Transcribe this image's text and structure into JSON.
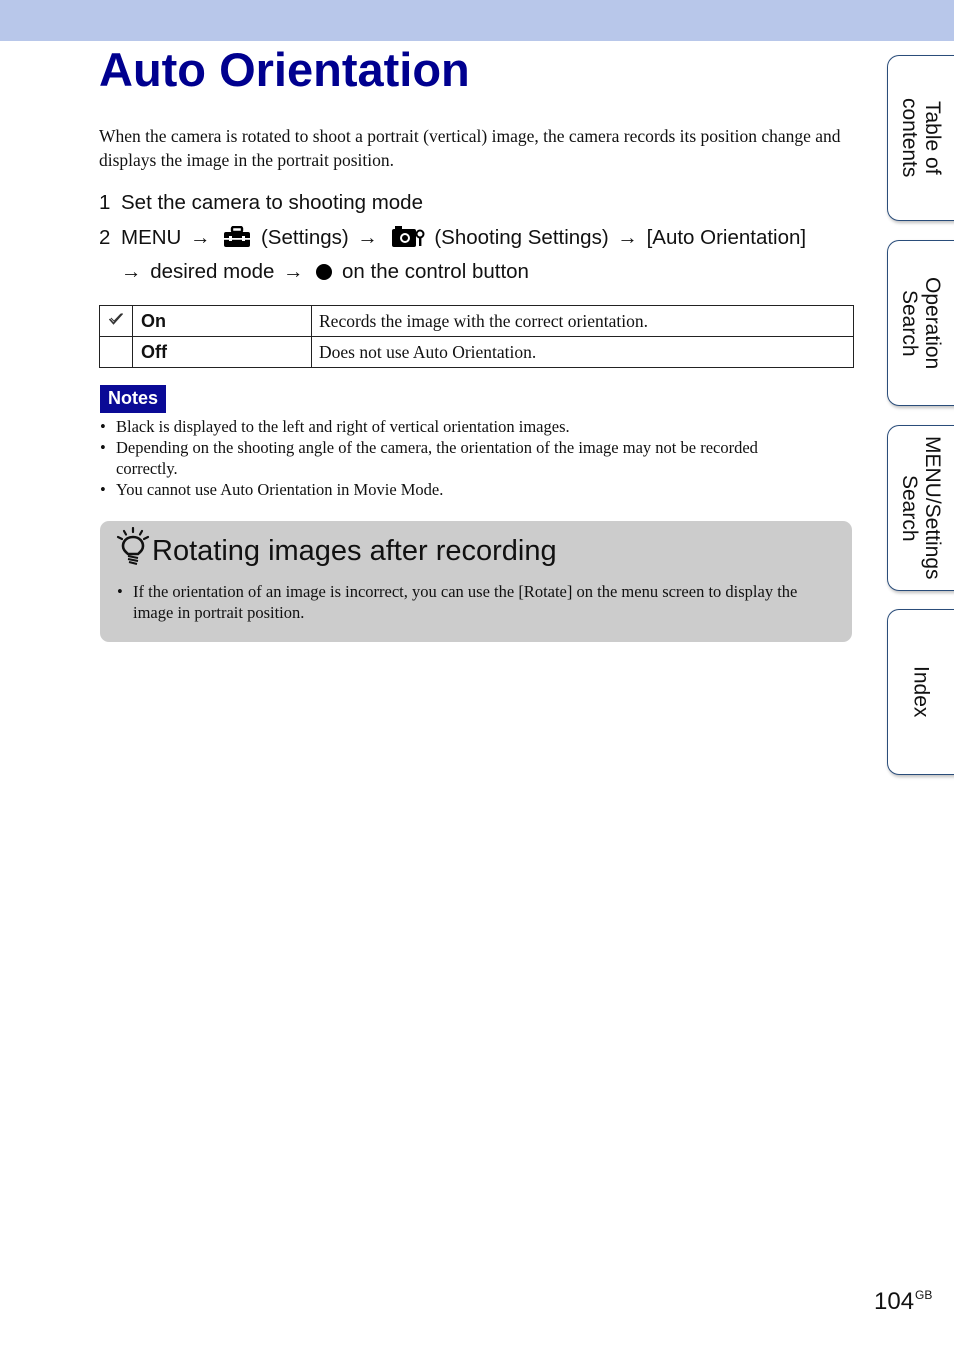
{
  "header": {
    "title": "Auto Orientation",
    "band_color": "#b8c7ea",
    "title_color": "#00008f"
  },
  "intro": "When the camera is rotated to shoot a portrait (vertical) image, the camera records its position change and displays the image in the portrait position.",
  "steps": [
    {
      "number": "1",
      "text": "Set the camera to shooting mode"
    },
    {
      "number": "2",
      "parts": {
        "menu": "MENU",
        "settings_icon": "toolbox-icon",
        "settings": "(Settings)",
        "shooting_icon": "camera-wrench-icon",
        "shooting": "(Shooting Settings)",
        "item": "[Auto Orientation]",
        "desired": "desired mode",
        "button_icon": "filled-circle-icon",
        "control": "on the control button"
      },
      "arrow": "→"
    }
  ],
  "options_table": {
    "rows": [
      {
        "default": true,
        "default_icon": "checkmark-icon",
        "name": "On",
        "description": "Records the image with the correct orientation."
      },
      {
        "default": false,
        "name": "Off",
        "description": "Does not use Auto Orientation."
      }
    ]
  },
  "notes": {
    "label": "Notes",
    "items": [
      "Black is displayed to the left and right of vertical orientation images.",
      "Depending on the shooting angle of the camera, the orientation of the image may not be recorded correctly.",
      "You cannot use Auto Orientation in Movie Mode."
    ]
  },
  "hint": {
    "icon": "lightbulb-icon",
    "title": "Rotating images after recording",
    "items": [
      "If the orientation of an image is incorrect, you can use the [Rotate] on the menu screen to display the image in portrait position."
    ]
  },
  "side_tabs": [
    {
      "label": "Table of\ncontents"
    },
    {
      "label": "Operation\nSearch"
    },
    {
      "label": "MENU/Settings\nSearch"
    },
    {
      "label": "Index"
    }
  ],
  "footer": {
    "page_number": "104",
    "suffix": "GB"
  }
}
